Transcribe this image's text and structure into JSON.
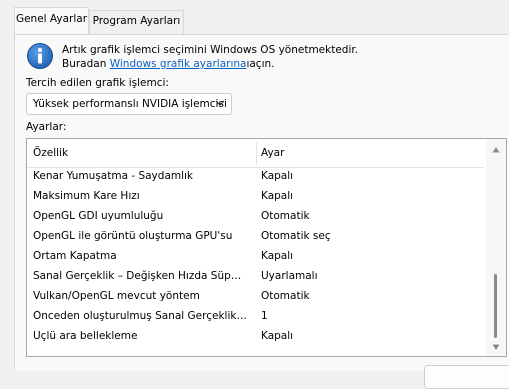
{
  "tabs": [
    {
      "label": "Genel Ayarlar",
      "active": true
    },
    {
      "label": "Program Ayarları",
      "active": false
    }
  ],
  "info": {
    "icon": "info-icon",
    "line1": "Artık grafik işlemci seçimini Windows OS yönetmektedir.",
    "line2_prefix": "Buradan",
    "link_text": "Windows grafik ayarlarına",
    "line2_suffix": "ıaçın."
  },
  "gpu": {
    "label": "Tercih edilen grafik işlemci:",
    "selected": "Yüksek performanslı NVIDIA işlemcisi"
  },
  "settings": {
    "label": "Ayarlar:",
    "columns": [
      "Özellik",
      "Ayar"
    ],
    "rows": [
      {
        "feature": "Kenar Yumuşatma - Saydamlık",
        "value": "Kapalı"
      },
      {
        "feature": "Maksimum Kare Hızı",
        "value": "Kapalı"
      },
      {
        "feature": "OpenGL GDI uyumluluğu",
        "value": "Otomatik"
      },
      {
        "feature": "OpenGL ile görüntü oluşturma GPU'su",
        "value": "Otomatik seç"
      },
      {
        "feature": "Ortam Kapatma",
        "value": "Kapalı"
      },
      {
        "feature": "Sanal Gerçeklik – Değişken Hızda Süper Örnekleme",
        "value": "Uyarlamalı"
      },
      {
        "feature": "Vulkan/OpenGL mevcut yöntem",
        "value": "Otomatik"
      },
      {
        "feature": "Önceden oluşturulmuş Sanal Gerçeklik kareleri",
        "value": "1"
      },
      {
        "feature": "Üçlü ara bellekleme",
        "value": "Kapalı"
      }
    ]
  },
  "colors": {
    "link": "#0b62c4",
    "info_icon": "#1e6fc4",
    "background": "#f0f0f0"
  }
}
